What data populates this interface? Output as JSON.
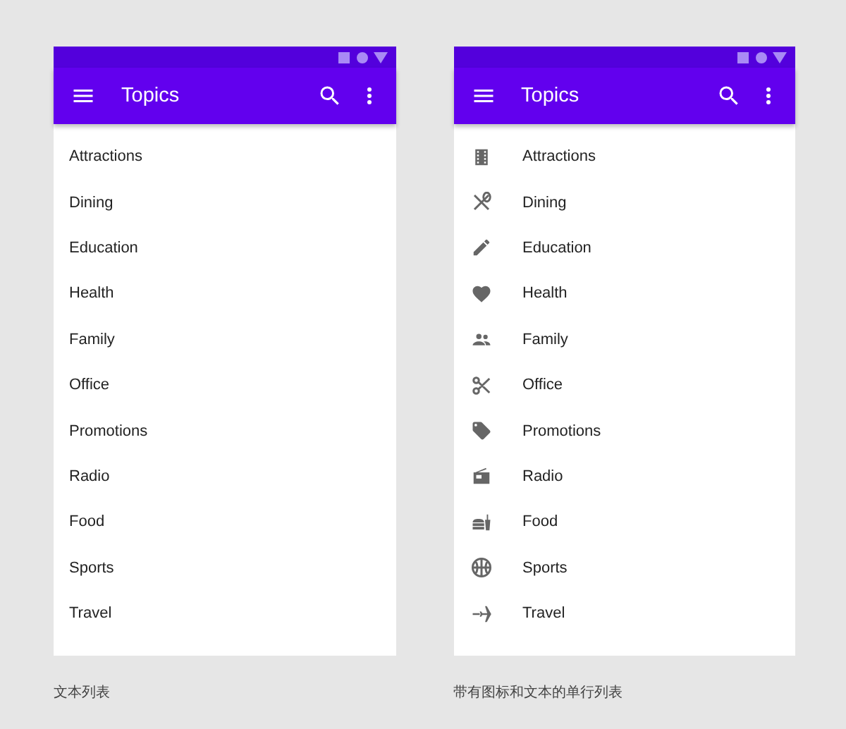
{
  "screens": [
    {
      "kind": "text",
      "app_bar": {
        "title": "Topics"
      },
      "items": [
        {
          "label": "Attractions"
        },
        {
          "label": "Dining"
        },
        {
          "label": "Education"
        },
        {
          "label": "Health"
        },
        {
          "label": "Family"
        },
        {
          "label": "Office"
        },
        {
          "label": "Promotions"
        },
        {
          "label": "Radio"
        },
        {
          "label": "Food"
        },
        {
          "label": "Sports"
        },
        {
          "label": "Travel"
        }
      ],
      "caption": "文本列表"
    },
    {
      "kind": "icon",
      "app_bar": {
        "title": "Topics"
      },
      "items": [
        {
          "label": "Attractions"
        },
        {
          "label": "Dining"
        },
        {
          "label": "Education"
        },
        {
          "label": "Health"
        },
        {
          "label": "Family"
        },
        {
          "label": "Office"
        },
        {
          "label": "Promotions"
        },
        {
          "label": "Radio"
        },
        {
          "label": "Food"
        },
        {
          "label": "Sports"
        },
        {
          "label": "Travel"
        }
      ],
      "caption": "带有图标和文本的单行列表"
    }
  ]
}
